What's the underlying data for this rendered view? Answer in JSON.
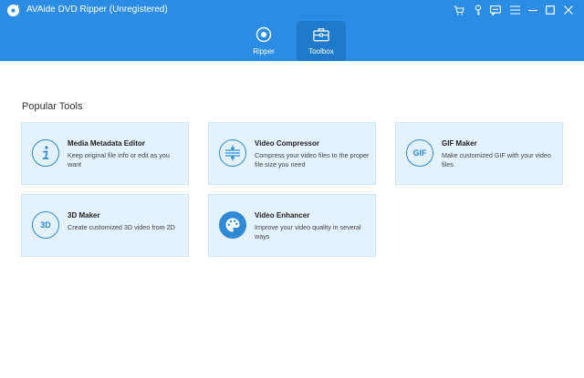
{
  "app": {
    "title": "AVAide DVD Ripper (Unregistered)"
  },
  "window_controls": [
    "cart-icon",
    "key-icon",
    "chat-icon",
    "menu-icon",
    "minimize-icon",
    "maximize-icon",
    "close-icon"
  ],
  "nav": {
    "tabs": [
      {
        "label": "Ripper",
        "icon": "ripper-icon",
        "active": false
      },
      {
        "label": "Toolbox",
        "icon": "toolbox-icon",
        "active": true
      }
    ]
  },
  "main": {
    "section_title": "Popular Tools",
    "tools": [
      {
        "name": "Media Metadata Editor",
        "desc": "Keep original file info or edit as you want",
        "icon": "info-icon"
      },
      {
        "name": "Video Compressor",
        "desc": "Compress your video files to the proper file size you need",
        "icon": "compress-icon"
      },
      {
        "name": "GIF Maker",
        "desc": "Make customized GIF with your video files",
        "icon": "gif-icon",
        "icon_text": "GIF"
      },
      {
        "name": "3D Maker",
        "desc": "Create customized 3D video from 2D",
        "icon": "3d-icon",
        "icon_text": "3D"
      },
      {
        "name": "Video Enhancer",
        "desc": "Improve your video quality in several ways",
        "icon": "palette-icon"
      }
    ]
  },
  "colors": {
    "header": "#2a8de3",
    "active_tab": "#1f7acb",
    "card_bg": "#e3f2fc",
    "icon_accent": "#2f8ad6"
  }
}
